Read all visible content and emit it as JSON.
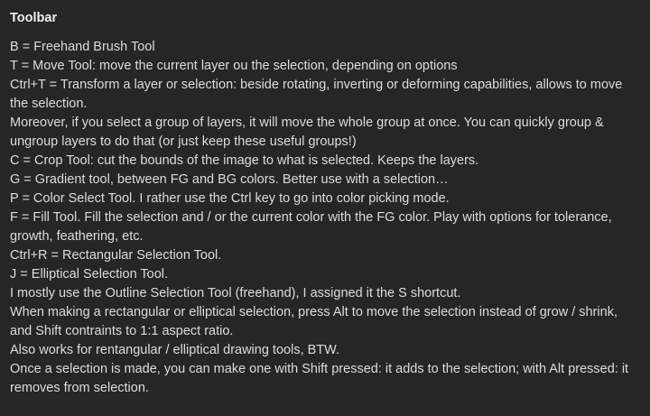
{
  "section": {
    "title": "Toolbar",
    "lines": [
      "B = Freehand Brush Tool",
      "T = Move Tool: move the current layer ou the selection, depending on options",
      "Ctrl+T = Transform a layer or selection: beside rotating, inverting or deforming capabilities, allows to move the selection.",
      "Moreover, if you select a group of layers, it will move the whole group at once. You can quickly group & ungroup layers to do that (or just keep these useful groups!)",
      "C = Crop Tool: cut the bounds of the image to what is selected. Keeps the layers.",
      "G = Gradient tool, between FG and BG colors. Better use with a selection…",
      "P = Color Select Tool. I rather use the Ctrl key to go into color picking mode.",
      "F = Fill Tool. Fill the selection and / or the current color with the FG color. Play with options for tolerance, growth, feathering, etc.",
      "Ctrl+R = Rectangular Selection Tool.",
      "J = Elliptical Selection Tool.",
      "I mostly use the Outline Selection Tool (freehand), I assigned it the S shortcut.",
      "When making a rectangular or elliptical selection, press Alt to move the selection instead of grow / shrink, and Shift contraints to 1:1 aspect ratio.",
      "Also works for rentangular / elliptical drawing tools, BTW.",
      "Once a selection is made, you can make one with Shift pressed: it adds to the selection; with Alt pressed: it removes from selection."
    ]
  }
}
